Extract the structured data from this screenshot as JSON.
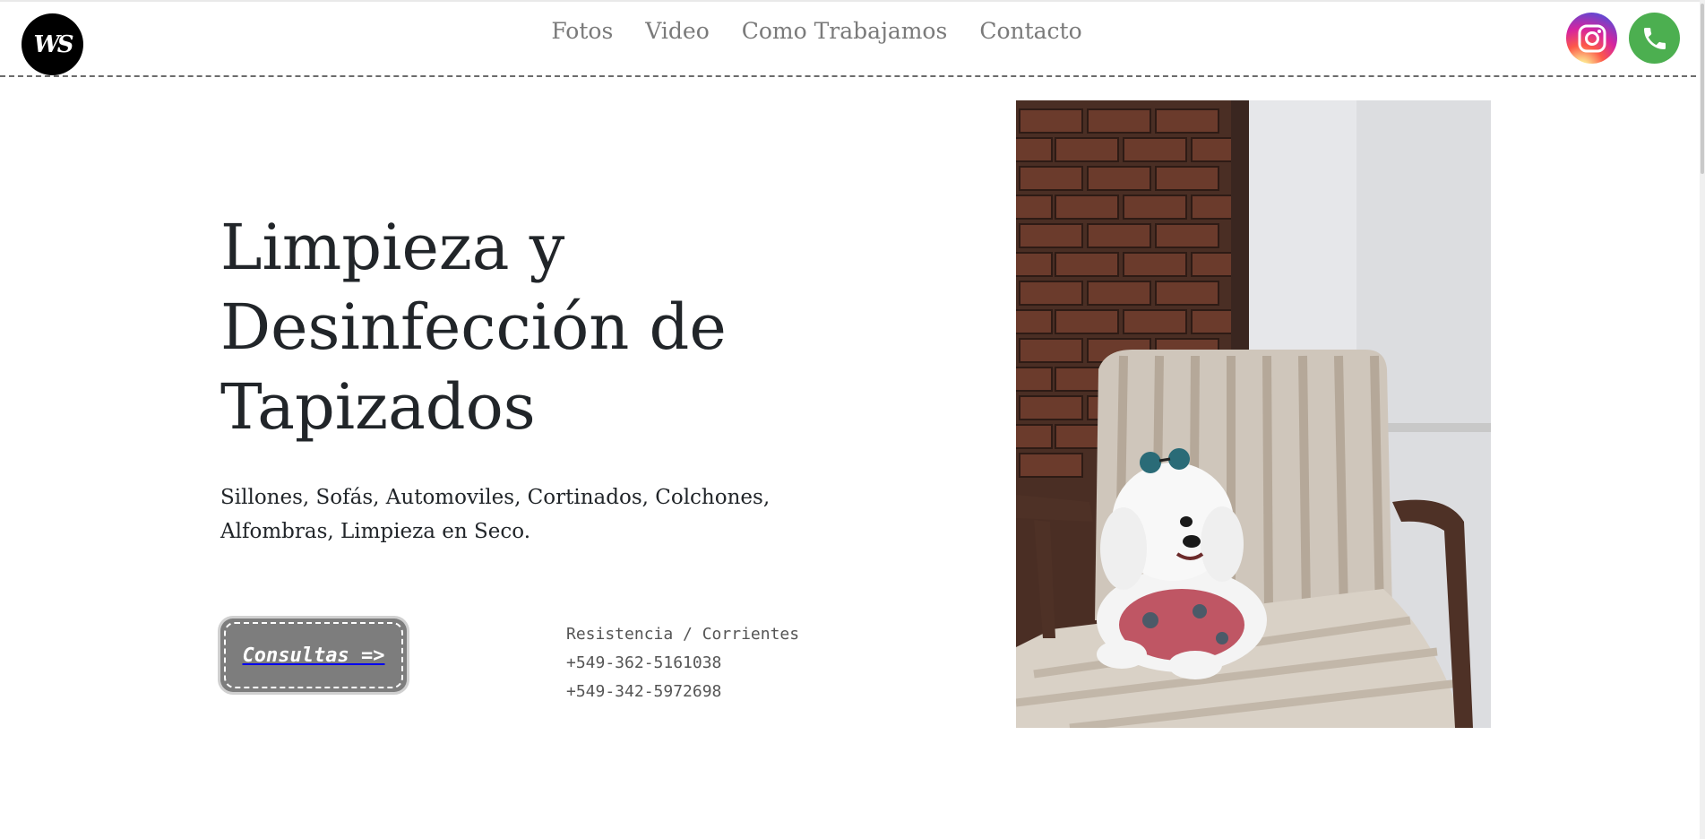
{
  "header": {
    "logo_text": "WS",
    "nav": [
      {
        "label": "Fotos"
      },
      {
        "label": "Video"
      },
      {
        "label": "Como Trabajamos"
      },
      {
        "label": "Contacto"
      }
    ],
    "social": [
      {
        "icon": "instagram-icon",
        "color": "#d6249f"
      },
      {
        "icon": "phone-icon",
        "color": "#4caf50"
      }
    ]
  },
  "hero": {
    "title": "Limpieza y Desinfección de Tapizados",
    "subtitle": "Sillones, Sofás, Automoviles, Cortinados, Colchones, Alfombras, Limpieza en Seco.",
    "cta_label": "Consultas =>",
    "location": "Resistencia / Corrientes",
    "phones": [
      "+549-362-5161038",
      "+549-342-5972698"
    ]
  },
  "photo": {
    "icon": "dog-on-armchair-photo"
  }
}
